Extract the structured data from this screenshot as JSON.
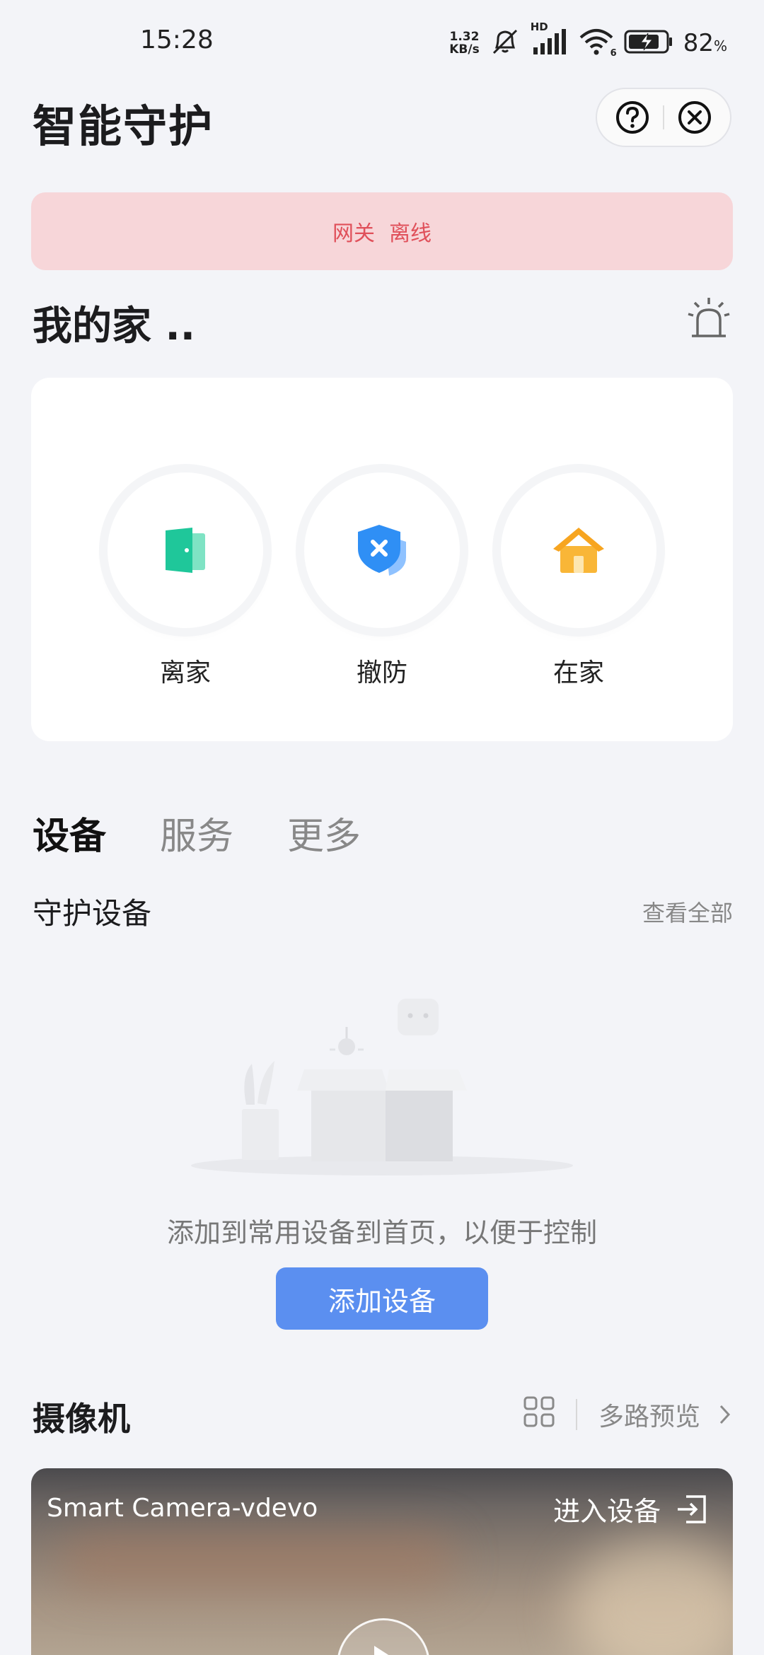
{
  "status_bar": {
    "time": "15:28",
    "net_speed_value": "1.32",
    "net_speed_unit": "KB/s",
    "signal_label": "HD",
    "wifi_label": "6",
    "battery_percent": "82",
    "battery_unit": "%"
  },
  "header": {
    "title": "智能守护"
  },
  "banner": {
    "gateway": "网关",
    "status": "离线"
  },
  "home": {
    "title": "我的家 .."
  },
  "modes": [
    {
      "label": "离家",
      "icon": "door-icon"
    },
    {
      "label": "撤防",
      "icon": "shield-x-icon"
    },
    {
      "label": "在家",
      "icon": "house-icon"
    }
  ],
  "tabs": [
    {
      "label": "设备",
      "active": true
    },
    {
      "label": "服务",
      "active": false
    },
    {
      "label": "更多",
      "active": false
    }
  ],
  "guard": {
    "title": "守护设备",
    "view_all": "查看全部",
    "empty_text": "添加到常用设备到首页，以便于控制",
    "add_button": "添加设备"
  },
  "camera": {
    "title": "摄像机",
    "multi_preview": "多路预览",
    "device_name": "Smart Camera-vdevo",
    "enter_device": "进入设备"
  },
  "colors": {
    "background": "#f3f4f8",
    "banner_bg": "#f7d6d9",
    "banner_text": "#e0505a",
    "primary_button": "#5b8ff0",
    "door_green": "#1fc79a",
    "shield_blue": "#2f8ff5",
    "house_orange": "#f7a520"
  }
}
